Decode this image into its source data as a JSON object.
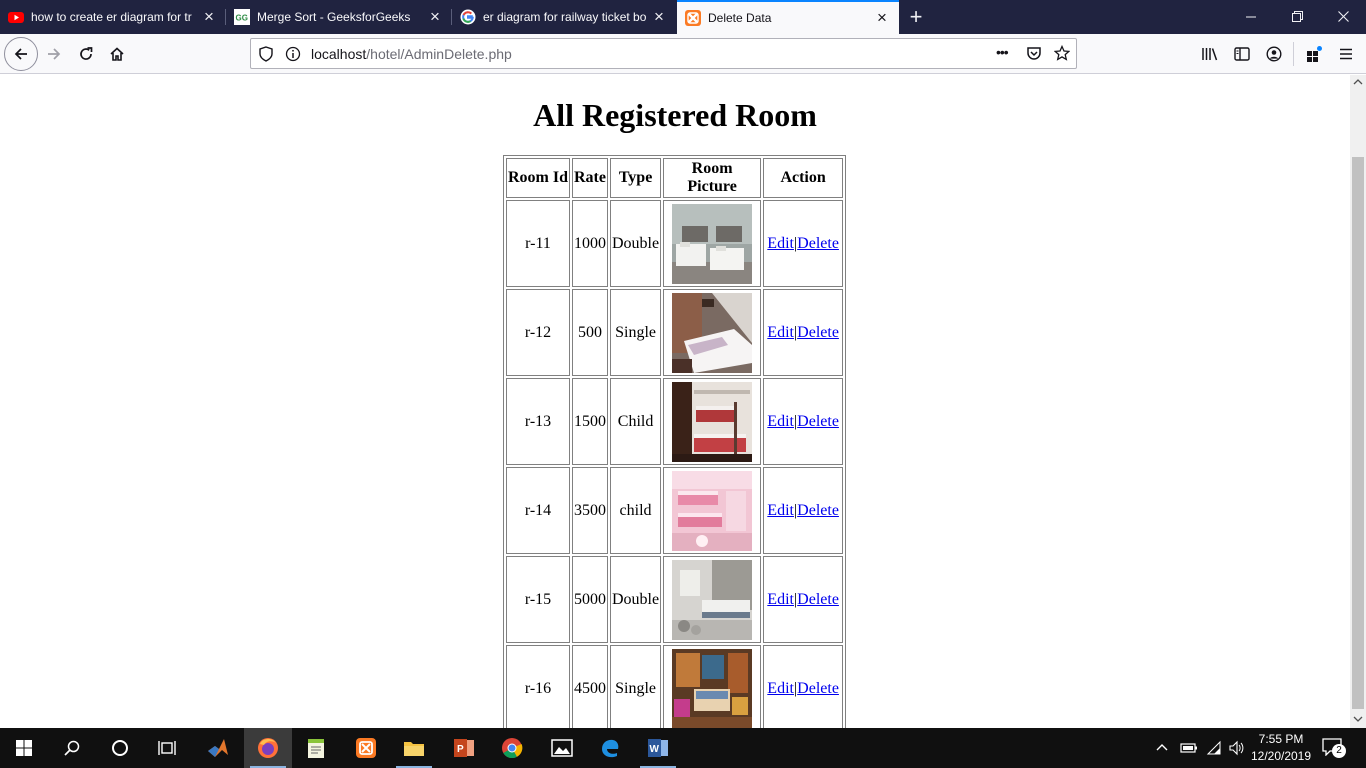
{
  "browser": {
    "tabs": [
      {
        "title": "how to create er diagram for tr",
        "favicon": "youtube-icon"
      },
      {
        "title": "Merge Sort - GeeksforGeeks",
        "favicon": "geeksforgeeks-icon"
      },
      {
        "title": "er diagram for railway ticket bo",
        "favicon": "google-icon"
      },
      {
        "title": "Delete Data",
        "favicon": "xampp-icon",
        "active": true
      }
    ],
    "new_tab_label": "+",
    "url_host": "localhost",
    "url_path": "/hotel/AdminDelete.php",
    "menu_dots": "•••"
  },
  "page": {
    "title": "All Registered Room",
    "columns": [
      "Room Id",
      "Rate",
      "Type",
      "Room Picture",
      "Action"
    ],
    "rows": [
      {
        "id": "r-11",
        "rate": "1000",
        "type": "Double",
        "edit": "Edit",
        "sep": "|",
        "delete": "Delete"
      },
      {
        "id": "r-12",
        "rate": "500",
        "type": "Single",
        "edit": "Edit",
        "sep": "|",
        "delete": "Delete"
      },
      {
        "id": "r-13",
        "rate": "1500",
        "type": "Child",
        "edit": "Edit",
        "sep": "|",
        "delete": "Delete"
      },
      {
        "id": "r-14",
        "rate": "3500",
        "type": "child",
        "edit": "Edit",
        "sep": "|",
        "delete": "Delete"
      },
      {
        "id": "r-15",
        "rate": "5000",
        "type": "Double",
        "edit": "Edit",
        "sep": "|",
        "delete": "Delete"
      },
      {
        "id": "r-16",
        "rate": "4500",
        "type": "Single",
        "edit": "Edit",
        "sep": "|",
        "delete": "Delete"
      }
    ]
  },
  "taskbar": {
    "time": "7:55 PM",
    "date": "12/20/2019",
    "notification_count": "2"
  },
  "colors": {
    "tab_strip": "#202340",
    "active_tab_accent": "#0a84ff",
    "link": "#0000ee",
    "taskbar": "#101010"
  }
}
